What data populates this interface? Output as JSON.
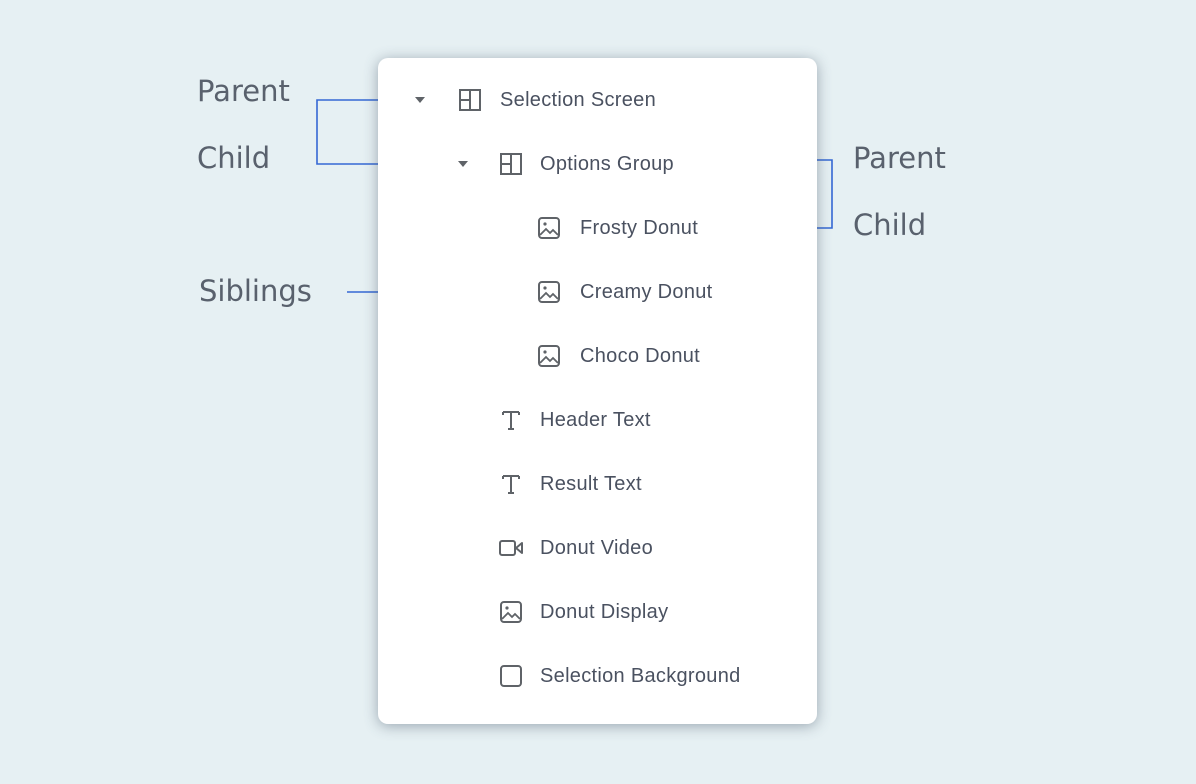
{
  "diagram": {
    "tree": [
      {
        "label": "Selection Screen",
        "icon": "layout-icon",
        "level": 0,
        "expandable": true
      },
      {
        "label": "Options Group",
        "icon": "layout-icon",
        "level": 1,
        "expandable": true
      },
      {
        "label": "Frosty Donut",
        "icon": "image-icon",
        "level": 2,
        "expandable": false
      },
      {
        "label": "Creamy Donut",
        "icon": "image-icon",
        "level": 2,
        "expandable": false
      },
      {
        "label": "Choco Donut",
        "icon": "image-icon",
        "level": 2,
        "expandable": false
      },
      {
        "label": "Header Text",
        "icon": "text-icon",
        "level": 1,
        "expandable": false
      },
      {
        "label": "Result Text",
        "icon": "text-icon",
        "level": 1,
        "expandable": false
      },
      {
        "label": "Donut Video",
        "icon": "video-icon",
        "level": 1,
        "expandable": false
      },
      {
        "label": "Donut Display",
        "icon": "image-icon",
        "level": 1,
        "expandable": false
      },
      {
        "label": "Selection Background",
        "icon": "rectangle-icon",
        "level": 1,
        "expandable": false
      }
    ],
    "annotations": {
      "left_parent": "Parent",
      "left_child": "Child",
      "siblings": "Siblings",
      "right_parent": "Parent",
      "right_child": "Child"
    },
    "colors": {
      "background": "#e6f0f3",
      "card": "#ffffff",
      "connector": "#3568d4",
      "annotation_text": "#59616d",
      "tree_text": "#4a5160"
    }
  }
}
